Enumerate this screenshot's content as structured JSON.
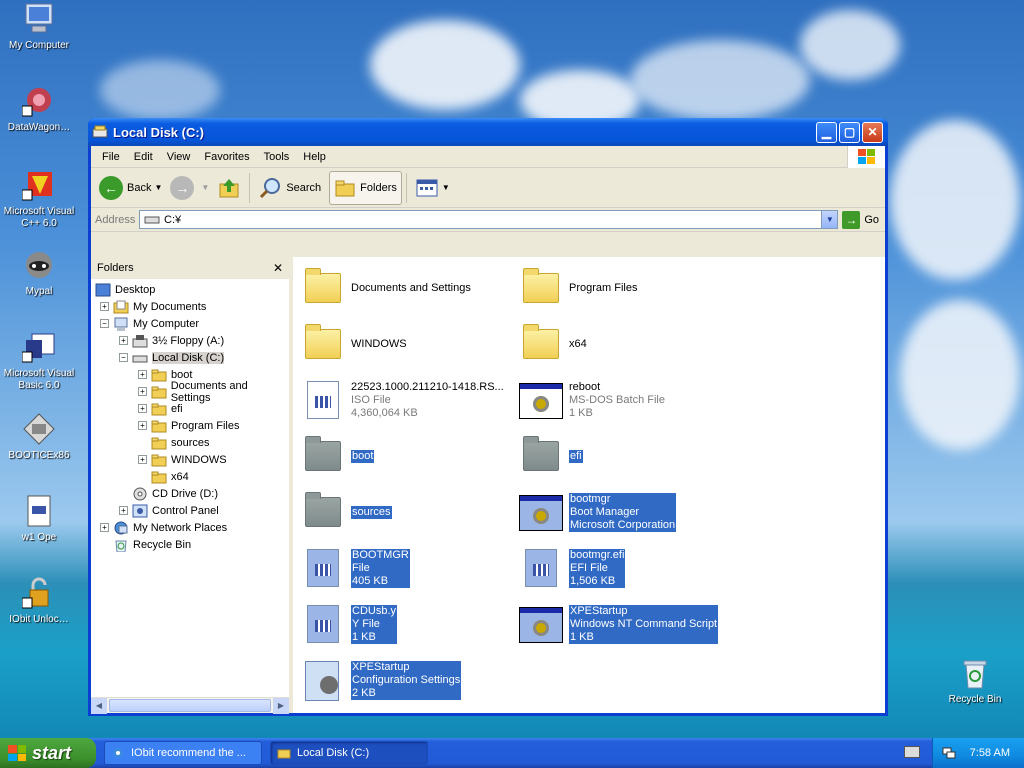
{
  "desktop": {
    "icons": [
      {
        "label": "My Computer"
      },
      {
        "label": "DataWagon…"
      },
      {
        "label": "Microsoft Visual C++ 6.0"
      },
      {
        "label": "Mypal"
      },
      {
        "label": "Microsoft Visual Basic 6.0"
      },
      {
        "label": "BOOTICEx86"
      },
      {
        "label": "w1 Ope"
      },
      {
        "label": "IObit Unloc…"
      },
      {
        "label": "Recycle Bin"
      }
    ]
  },
  "window": {
    "title": "Local Disk (C:)",
    "menu": [
      "File",
      "Edit",
      "View",
      "Favorites",
      "Tools",
      "Help"
    ],
    "toolbar": {
      "back": "Back",
      "search": "Search",
      "folders": "Folders"
    },
    "address": {
      "label": "Address",
      "value": "C:¥",
      "go": "Go"
    },
    "folders_pane": {
      "title": "Folders",
      "tree": [
        {
          "label": "Desktop"
        },
        {
          "label": "My Documents"
        },
        {
          "label": "My Computer"
        },
        {
          "label": "3½ Floppy (A:)"
        },
        {
          "label": "Local Disk (C:)"
        },
        {
          "label": "boot"
        },
        {
          "label": "Documents and Settings"
        },
        {
          "label": "efi"
        },
        {
          "label": "Program Files"
        },
        {
          "label": "sources"
        },
        {
          "label": "WINDOWS"
        },
        {
          "label": "x64"
        },
        {
          "label": "CD Drive (D:)"
        },
        {
          "label": "Control Panel"
        },
        {
          "label": "My Network Places"
        },
        {
          "label": "Recycle Bin"
        }
      ]
    },
    "files": [
      {
        "name": "Documents and Settings",
        "type": "",
        "size": ""
      },
      {
        "name": "Program Files",
        "type": "",
        "size": ""
      },
      {
        "name": "WINDOWS",
        "type": "",
        "size": ""
      },
      {
        "name": "x64",
        "type": "",
        "size": ""
      },
      {
        "name": "22523.1000.211210-1418.RS...",
        "type": "ISO File",
        "size": "4,360,064 KB"
      },
      {
        "name": "reboot",
        "type": "MS-DOS Batch File",
        "size": "1 KB"
      },
      {
        "name": "boot",
        "type": "",
        "size": ""
      },
      {
        "name": "efi",
        "type": "",
        "size": ""
      },
      {
        "name": "sources",
        "type": "",
        "size": ""
      },
      {
        "name": "bootmgr",
        "type": "Boot Manager",
        "size": "Microsoft Corporation"
      },
      {
        "name": "BOOTMGR",
        "type": "File",
        "size": "405 KB"
      },
      {
        "name": "bootmgr.efi",
        "type": "EFI File",
        "size": "1,506 KB"
      },
      {
        "name": "CDUsb.y",
        "type": "Y File",
        "size": "1 KB"
      },
      {
        "name": "XPEStartup",
        "type": "Windows NT Command Script",
        "size": "1 KB"
      },
      {
        "name": "XPEStartup",
        "type": "Configuration Settings",
        "size": "2 KB"
      }
    ]
  },
  "taskbar": {
    "start": "start",
    "tasks": [
      {
        "label": "IObit recommend the ..."
      },
      {
        "label": "Local Disk (C:)"
      }
    ],
    "clock": "7:58 AM"
  }
}
